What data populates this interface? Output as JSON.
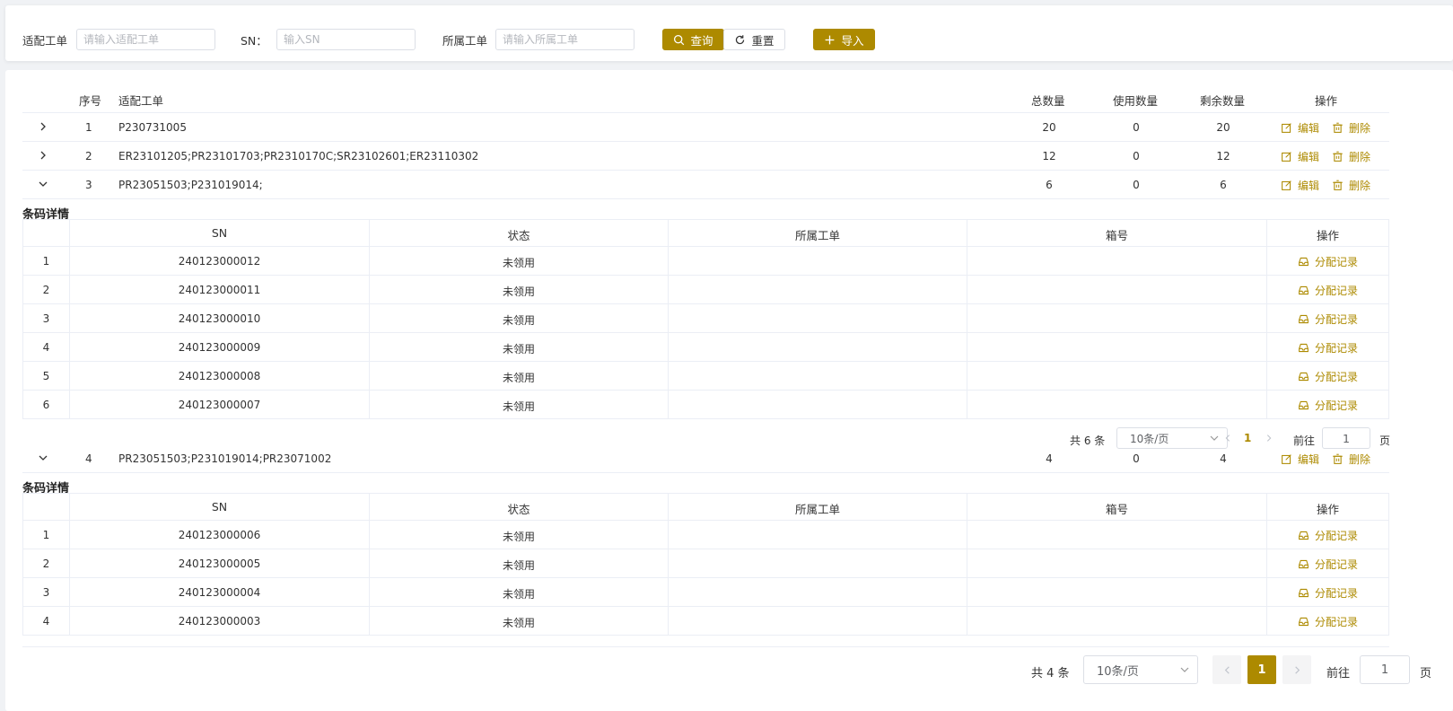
{
  "search": {
    "adapt_label": "适配工单",
    "adapt_placeholder": "请输入适配工单",
    "sn_label": "SN：",
    "sn_placeholder": "输入SN",
    "owner_label": "所属工单",
    "owner_placeholder": "请输入所属工单",
    "query_label": "查询",
    "reset_label": "重置",
    "import_label": "导入"
  },
  "table": {
    "headers": {
      "index": "序号",
      "adapt_order": "适配工单",
      "total": "总数量",
      "used": "使用数量",
      "remaining": "剩余数量",
      "actions": "操作"
    },
    "edit_label": "编辑",
    "delete_label": "删除",
    "rows": [
      {
        "index": "1",
        "order": "P230731005",
        "total": "20",
        "used": "0",
        "remaining": "20",
        "expanded": false
      },
      {
        "index": "2",
        "order": "ER23101205;PR23101703;PR2310170C;SR23102601;ER23110302",
        "total": "12",
        "used": "0",
        "remaining": "12",
        "expanded": false
      },
      {
        "index": "3",
        "order": "PR23051503;P231019014;",
        "total": "6",
        "used": "0",
        "remaining": "6",
        "expanded": true
      },
      {
        "index": "4",
        "order": "PR23051503;P231019014;PR23071002",
        "total": "4",
        "used": "0",
        "remaining": "4",
        "expanded": true
      }
    ]
  },
  "detail": {
    "title": "条码详情",
    "headers": {
      "sn": "SN",
      "status": "状态",
      "owner": "所属工单",
      "box": "箱号",
      "actions": "操作"
    },
    "record_label": "分配记录",
    "row3_items": [
      {
        "index": "1",
        "sn": "240123000012",
        "status": "未领用"
      },
      {
        "index": "2",
        "sn": "240123000011",
        "status": "未领用"
      },
      {
        "index": "3",
        "sn": "240123000010",
        "status": "未领用"
      },
      {
        "index": "4",
        "sn": "240123000009",
        "status": "未领用"
      },
      {
        "index": "5",
        "sn": "240123000008",
        "status": "未领用"
      },
      {
        "index": "6",
        "sn": "240123000007",
        "status": "未领用"
      }
    ],
    "row3_pager": {
      "total": "共 6 条",
      "page_size": "10条/页",
      "current": "1",
      "goto": "前往",
      "goto_value": "1",
      "page_unit": "页"
    },
    "row4_items": [
      {
        "index": "1",
        "sn": "240123000006",
        "status": "未领用"
      },
      {
        "index": "2",
        "sn": "240123000005",
        "status": "未领用"
      },
      {
        "index": "3",
        "sn": "240123000004",
        "status": "未领用"
      },
      {
        "index": "4",
        "sn": "240123000003",
        "status": "未领用"
      }
    ]
  },
  "pager": {
    "total": "共 4 条",
    "page_size": "10条/页",
    "current": "1",
    "goto": "前往",
    "goto_value": "1",
    "page_unit": "页"
  },
  "colors": {
    "accent": "#ad8a00",
    "border": "#ebeef5"
  }
}
